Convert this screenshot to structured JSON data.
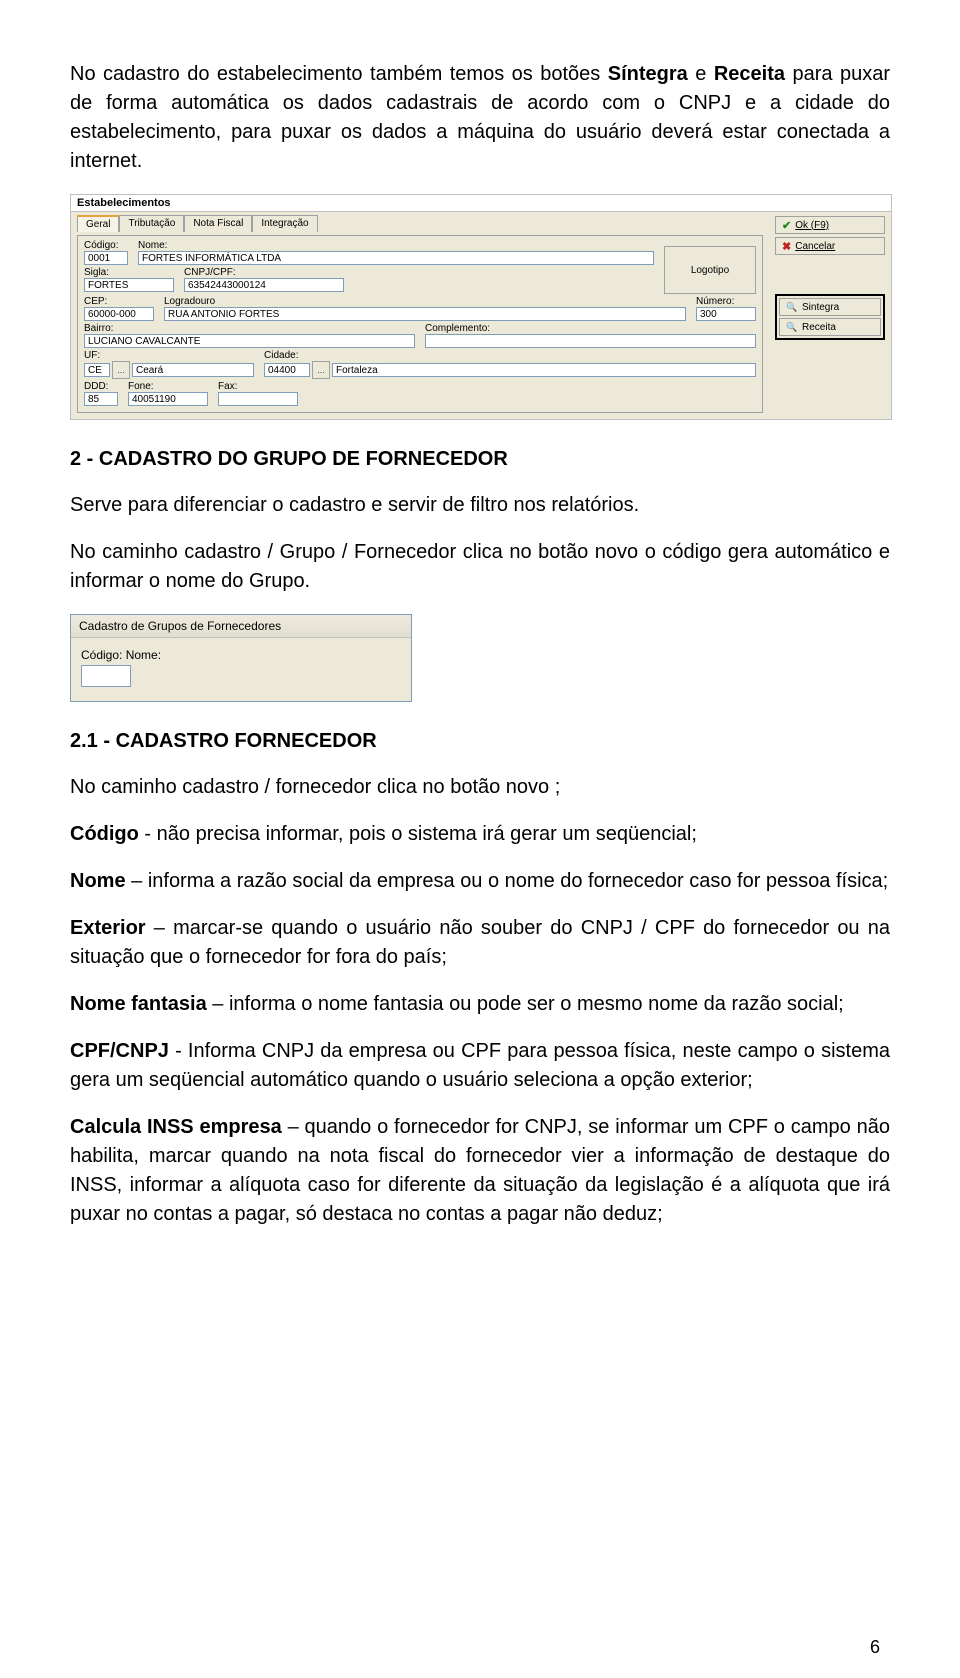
{
  "intro": {
    "p1_pre": "No cadastro do estabelecimento também temos os botões ",
    "p1_b1": "Síntegra",
    "p1_mid": " e ",
    "p1_b2": "Receita",
    "p1_post": " para puxar de forma automática os dados cadastrais de acordo com o CNPJ e a cidade do estabelecimento, para puxar os dados a máquina do usuário deverá estar conectada a internet."
  },
  "ss1": {
    "window_title": "Estabelecimentos",
    "tabs": {
      "geral": "Geral",
      "tributacao": "Tributação",
      "nota_fiscal": "Nota Fiscal",
      "integracao": "Integração"
    },
    "labels": {
      "codigo": "Código:",
      "nome": "Nome:",
      "sigla": "Sigla:",
      "cnpj": "CNPJ/CPF:",
      "cep": "CEP:",
      "logradouro": "Logradouro",
      "numero": "Número:",
      "bairro": "Bairro:",
      "complemento": "Complemento:",
      "uf": "UF:",
      "cidade": "Cidade:",
      "ddd": "DDD:",
      "fone": "Fone:",
      "fax": "Fax:",
      "logotipo": "Logotipo"
    },
    "values": {
      "codigo": "0001",
      "nome": "FORTES INFORMÁTICA LTDA",
      "sigla": "FORTES",
      "cnpj": "63542443000124",
      "cep": "60000-000",
      "logradouro": "RUA ANTONIO FORTES",
      "numero": "300",
      "bairro": "LUCIANO CAVALCANTE",
      "complemento": "",
      "uf_code": "CE",
      "uf_name": "Ceará",
      "cidade_code": "04400",
      "cidade_name": "Fortaleza",
      "ddd": "85",
      "fone": "40051190",
      "fax": ""
    },
    "buttons": {
      "ok": "Ok  (F9)",
      "cancelar": "Cancelar",
      "sintegra": "Sintegra",
      "receita": "Receita"
    }
  },
  "sec2": {
    "title": "2 - CADASTRO DO GRUPO DE FORNECEDOR",
    "p1": "Serve para diferenciar  o cadastro e servir de filtro nos  relatórios.",
    "p2": "No caminho cadastro / Grupo / Fornecedor  clica no botão novo o código gera automático e informar o nome do Grupo."
  },
  "ss2": {
    "title": "Cadastro de Grupos de Fornecedores",
    "label": "Código: Nome:",
    "value": ""
  },
  "sec21": {
    "title": "2.1 -  CADASTRO FORNECEDOR",
    "p1": "No caminho cadastro / fornecedor  clica no botão novo ;",
    "codigo_b": "Código",
    "codigo_t": " - não precisa informar, pois o sistema irá gerar um seqüencial;",
    "nome_b": "Nome",
    "nome_t": " – informa a razão social da empresa ou o nome do fornecedor  caso for pessoa física;",
    "exterior_b": "Exterior",
    "exterior_t": " – marcar-se quando o usuário não souber do CNPJ / CPF do fornecedor ou na situação que o fornecedor  for fora do país;",
    "fantasia_b": "Nome fantasia",
    "fantasia_t": " – informa o nome fantasia ou pode ser o mesmo nome da razão social;",
    "cpf_b": "CPF/CNPJ",
    "cpf_t": "  - Informa CNPJ da empresa ou CPF para pessoa  física, neste campo o sistema gera um seqüencial automático quando o usuário seleciona a opção exterior;",
    "inss_b": "Calcula INSS empresa",
    "inss_t": " –  quando o fornecedor for CNPJ,  se informar um CPF o campo não habilita, marcar quando na nota fiscal do fornecedor vier a informação de destaque do INSS, informar a alíquota caso for diferente da situação da legislação é a alíquota que irá puxar no contas a pagar, só destaca no contas a pagar não deduz;"
  },
  "page_num": "6"
}
